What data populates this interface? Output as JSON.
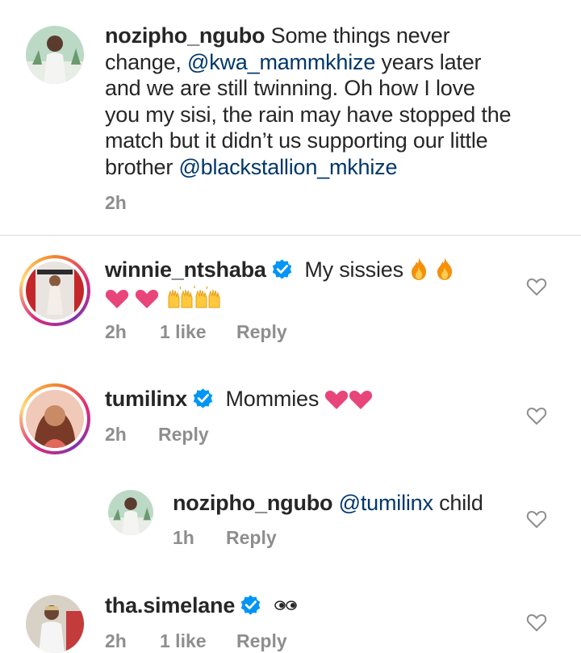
{
  "comments": [
    {
      "username": "nozipho_ngubo",
      "text_part1": "Some things never",
      "text_line2_a": "change,",
      "mention1": "@kwa_mammkhize",
      "text_line2_b": "years later",
      "text_line3": "and we are still twinning. Oh how I love",
      "text_line4": "you my sisi, the rain may have stopped the",
      "text_line5": "match but it didn’t us supporting our little",
      "text_line6_a": "brother",
      "mention2": "@blackstallion_mkhize",
      "time": "2h"
    },
    {
      "username": "winnie_ntshaba",
      "text": "My sissies",
      "time": "2h",
      "likes": "1 like",
      "reply": "Reply"
    },
    {
      "username": "tumilinx",
      "text": "Mommies",
      "time": "2h",
      "reply": "Reply"
    },
    {
      "username": "nozipho_ngubo",
      "mention": "@tumilinx",
      "text": "child",
      "time": "1h",
      "reply": "Reply"
    },
    {
      "username": "tha.simelane",
      "time": "2h",
      "likes": "1 like",
      "reply": "Reply"
    }
  ],
  "colors": {
    "mention": "#00376b",
    "verified": "#0095f6",
    "meta": "#8e8e8e",
    "heart": "#e8457a"
  },
  "icons": [
    "verified-badge-icon",
    "heart-outline-icon",
    "fire-emoji",
    "pink-heart-emoji",
    "raised-hands-emoji",
    "eyes-emoji"
  ]
}
